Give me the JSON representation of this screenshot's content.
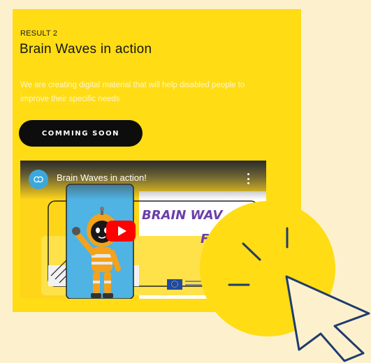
{
  "result": {
    "eyebrow": "RESULT 2",
    "title": "Brain Waves in action",
    "description": "We are creating digital material that will help disabled people to improve their specific needs",
    "cta_label": "COMMING SOON"
  },
  "video": {
    "title": "Brain Waves in action!",
    "thumbnail_text_1": "BRAIN WAV",
    "thumbnail_text_2": "F",
    "channel_icon": "brain-icon",
    "menu_icon": "more-vert-icon",
    "play_icon": "play-icon"
  },
  "colors": {
    "background": "#fdf1cd",
    "card": "#ffdc14",
    "button": "#0d0d0d",
    "accent_purple": "#6b3fa8",
    "youtube_red": "#ff0000",
    "cursor_stroke": "#1f3c6e"
  },
  "decor": {
    "cursor_icon": "pointer-cursor-icon"
  }
}
